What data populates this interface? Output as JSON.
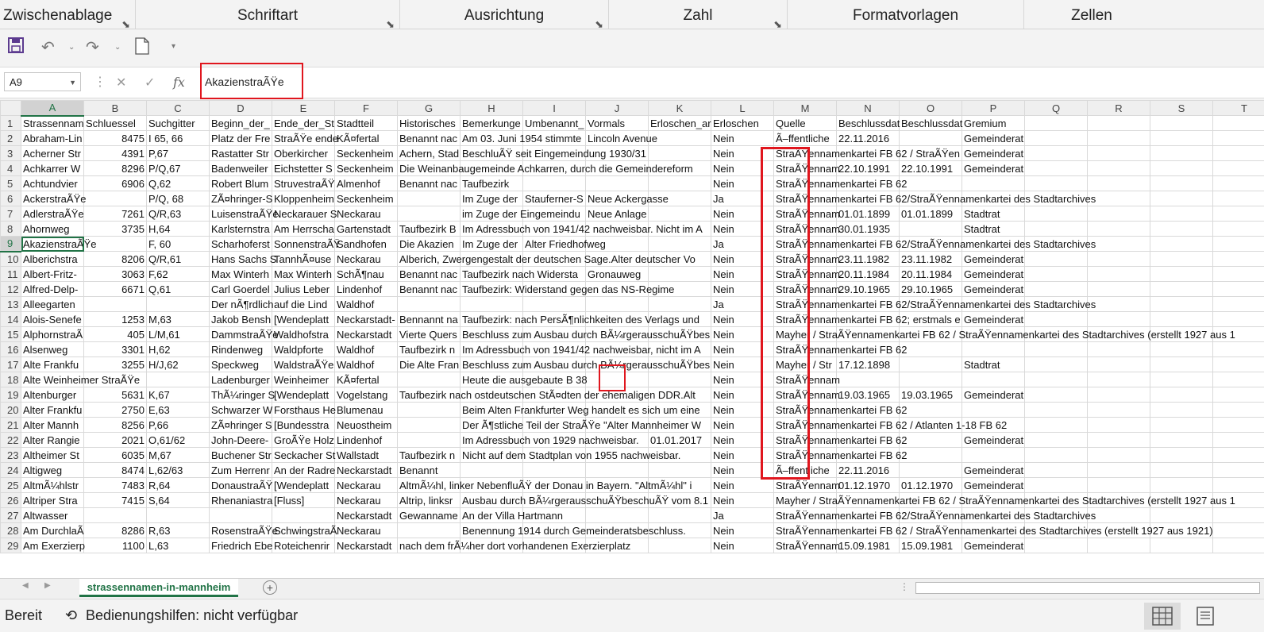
{
  "ribbon": {
    "groups": [
      "Zwischenablage",
      "Schriftart",
      "Ausrichtung",
      "Zahl",
      "Formatvorlagen",
      "Zellen"
    ]
  },
  "name_box": "A9",
  "formula": "AkazienstraÃŸe",
  "fx_label": "fx",
  "columns": [
    "A",
    "B",
    "C",
    "D",
    "E",
    "F",
    "G",
    "H",
    "I",
    "J",
    "K",
    "L",
    "M",
    "N",
    "O",
    "P",
    "Q",
    "R",
    "S",
    "T"
  ],
  "rows": [
    [
      "Strassennam",
      "Schluessel",
      "Suchgitter",
      "Beginn_der_",
      "Ende_der_St",
      "Stadtteil",
      "Historisches",
      "Bemerkunge",
      "Umbenannt_",
      "Vormals",
      "Erloschen_ar",
      "Erloschen",
      "Quelle",
      "Beschlussdat",
      "Beschlussdat",
      "Gremium"
    ],
    [
      "Abraham-Lin",
      "8475",
      "I 65, 66",
      "Platz der Fre",
      "StraÃŸe ende",
      "KÃ¤fertal",
      "Benannt nac",
      "Am 03. Juni 1954 stimmte",
      "",
      "Lincoln Avenue",
      "",
      "Nein",
      "Ã–ffentliche",
      "22.11.2016",
      "",
      "Gemeinderat"
    ],
    [
      "Acherner Str",
      "4391",
      "P,67",
      "Rastatter Str",
      "Oberkircher",
      "Seckenheim",
      "Achern, Stad",
      "BeschluÃŸ seit Eingemeindung 1930/31",
      "",
      "",
      "",
      "Nein",
      "StraÃŸennamenkartei FB 62 / StraÃŸen",
      "",
      "",
      "Gemeinderat"
    ],
    [
      "Achkarrer W",
      "8296",
      "P/Q,67",
      "Badenweiler",
      "Eichstetter S",
      "Seckenheim",
      "Die Weinanbaugemeinde Achkarren, durch die Gemeindereform",
      "",
      "",
      "",
      "",
      "Nein",
      "StraÃŸennam",
      "22.10.1991",
      "22.10.1991",
      "Gemeinderat"
    ],
    [
      "Achtundvier",
      "6906",
      "Q,62",
      "Robert Blum",
      "StruvestraÃŸ",
      "Almenhof",
      "Benannt nac",
      "Taufbezirk",
      "",
      "",
      "",
      "Nein",
      "StraÃŸennamenkartei FB 62",
      "",
      "",
      ""
    ],
    [
      "AckerstraÃŸe",
      "",
      "P/Q, 68",
      "ZÃ¤hringer-S",
      "Kloppenheim",
      "Seckenheim",
      "",
      "Im Zuge der",
      "Stauferner-S",
      "Neue Ackergasse",
      "",
      "Ja",
      "StraÃŸennamenkartei FB 62/StraÃŸennamenkartei des Stadtarchives",
      "",
      "",
      ""
    ],
    [
      "AdlerstraÃŸe",
      "7261",
      "Q/R,63",
      "LuisenstraÃŸe",
      "Neckarauer S",
      "Neckarau",
      "",
      "im Zuge der Eingemeindu",
      "",
      "Neue Anlage",
      "",
      "Nein",
      "StraÃŸennam",
      "01.01.1899",
      "01.01.1899",
      "Stadtrat"
    ],
    [
      "Ahornweg",
      "3735",
      "H,64",
      "Karlsternstra",
      "Am Herrscha",
      "Gartenstadt",
      "Taufbezirk B",
      "Im Adressbuch von 1941/42 nachweisbar. Nicht im A",
      "",
      "",
      "",
      "Nein",
      "StraÃŸennam",
      "30.01.1935",
      "",
      "Stadtrat"
    ],
    [
      "AkazienstraÃŸe",
      "",
      "F, 60",
      "Scharhoferst",
      "SonnenstraÃŸ",
      "Sandhofen",
      "Die Akazien",
      "Im Zuge der",
      "Alter Friedhofweg",
      "",
      "",
      "Ja",
      "StraÃŸennamenkartei FB 62/StraÃŸennamenkartei des Stadtarchives",
      "",
      "",
      ""
    ],
    [
      "Alberichstra",
      "8206",
      "Q/R,61",
      "Hans Sachs S",
      "TannhÃ¤use",
      "Neckarau",
      "Alberich, Zwergengestalt der deutschen Sage.Alter deutscher Vo",
      "",
      "",
      "",
      "",
      "Nein",
      "StraÃŸennam",
      "23.11.1982",
      "23.11.1982",
      "Gemeinderat"
    ],
    [
      "Albert-Fritz-",
      "3063",
      "F,62",
      "Max Winterh",
      "Max Winterh",
      "SchÃ¶nau",
      "Benannt nac",
      "Taufbezirk nach Widersta",
      "",
      "Gronauweg",
      "",
      "Nein",
      "StraÃŸennam",
      "20.11.1984",
      "20.11.1984",
      "Gemeinderat"
    ],
    [
      "Alfred-Delp-",
      "6671",
      "Q,61",
      "Carl Goerdel",
      "Julius Leber",
      "Lindenhof",
      "Benannt nac",
      "Taufbezirk: Widerstand gegen das NS-Regime",
      "",
      "",
      "",
      "Nein",
      "StraÃŸennam",
      "29.10.1965",
      "29.10.1965",
      "Gemeinderat"
    ],
    [
      "Alleegarten",
      "",
      "",
      "Der nÃ¶rdlich",
      "auf die Lind",
      "Waldhof",
      "",
      "",
      "",
      "",
      "",
      "Ja",
      "StraÃŸennamenkartei FB 62/StraÃŸennamenkartei des Stadtarchives",
      "",
      "",
      ""
    ],
    [
      "Alois-Senefe",
      "1253",
      "M,63",
      "Jakob Bensh",
      "[Wendeplatt",
      "Neckarstadt-",
      "Bennannt na",
      "Taufbezirk: nach PersÃ¶nlichkeiten des Verlags und",
      "",
      "",
      "",
      "Nein",
      "StraÃŸennamenkartei FB 62; erstmals e",
      "",
      "",
      "Gemeinderat"
    ],
    [
      "AlphornstraÃ",
      "405",
      "L/M,61",
      "DammstraÃŸe",
      "Waldhofstra",
      "Neckarstadt",
      "Vierte Quers",
      "Beschluss zum Ausbau durch BÃ¼rgerausschuÃŸbes",
      "",
      "",
      "",
      "Nein",
      "Mayher /  StraÃŸennamenkartei FB 62 / StraÃŸennamenkartei des Stadtarchives (erstellt 1927 aus 1",
      "",
      "",
      ""
    ],
    [
      "Alsenweg",
      "3301",
      "H,62",
      "Rindenweg",
      "Waldpforte",
      "Waldhof",
      "Taufbezirk n",
      "Im Adressbuch von 1941/42 nachweisbar, nicht im A",
      "",
      "",
      "",
      "Nein",
      "StraÃŸennamenkartei FB 62",
      "",
      "",
      ""
    ],
    [
      "Alte Frankfu",
      "3255",
      "H/J,62",
      "Speckweg",
      "WaldstraÃŸe",
      "Waldhof",
      "Die Alte Fran",
      "Beschluss zum Ausbau durch BÃ¼rgerausschuÃŸbes",
      "",
      "",
      "",
      "Nein",
      "Mayher / Str",
      "17.12.1898",
      "",
      "Stadtrat"
    ],
    [
      "Alte Weinheimer StraÃŸe",
      "",
      "",
      "Ladenburger",
      "Weinheimer",
      "KÃ¤fertal",
      "",
      "Heute die ausgebaute B 38",
      "",
      "",
      "",
      "Nein",
      "StraÃŸennam",
      "",
      "",
      ""
    ],
    [
      "Altenburger",
      "5631",
      "K,67",
      "ThÃ¼ringer S",
      "[Wendeplatt",
      "Vogelstang",
      "Taufbezirk nach ostdeutschen StÃ¤dten der ehemaligen DDR.Alt",
      "",
      "",
      "",
      "",
      "Nein",
      "StraÃŸennam",
      "19.03.1965",
      "19.03.1965",
      "Gemeinderat"
    ],
    [
      "Alter Frankfu",
      "2750",
      "E,63",
      "Schwarzer W",
      "Forsthaus He",
      "Blumenau",
      "",
      "Beim Alten Frankfurter Weg handelt es sich um eine",
      "",
      "",
      "",
      "Nein",
      "StraÃŸennamenkartei FB 62",
      "",
      "",
      ""
    ],
    [
      "Alter Mannh",
      "8256",
      "P,66",
      "ZÃ¤hringer S",
      "[Bundesstra",
      "Neuostheim",
      "",
      "Der Ã¶stliche Teil der StraÃŸe  \"Alter Mannheimer W",
      "",
      "",
      "",
      "Nein",
      "StraÃŸennamenkartei FB 62 / Atlanten 1-18 FB 62",
      "",
      "",
      ""
    ],
    [
      "Alter Rangie",
      "2021",
      "O,61/62",
      "John-Deere-",
      "GroÃŸe Holz",
      "Lindenhof",
      "",
      "Im Adressbuch von 1929 nachweisbar.",
      "",
      "",
      "01.01.2017",
      "Nein",
      "StraÃŸennamenkartei FB 62",
      "",
      "",
      "Gemeinderat"
    ],
    [
      "Altheimer St",
      "6035",
      "M,67",
      "Buchener Str",
      "Seckacher St",
      "Wallstadt",
      "Taufbezirk n",
      "Nicht auf dem Stadtplan von 1955 nachweisbar.",
      "",
      "",
      "",
      "Nein",
      "StraÃŸennamenkartei FB 62",
      "",
      "",
      ""
    ],
    [
      "Altigweg",
      "8474",
      "L,62/63",
      "Zum Herrenr",
      "An der Radre",
      "Neckarstadt",
      "Benannt",
      "",
      "",
      "",
      "",
      "Nein",
      "Ã–ffentliche",
      "22.11.2016",
      "",
      "Gemeinderat"
    ],
    [
      "AltmÃ¼hlstr",
      "7483",
      "R,64",
      "DonaustraÃŸ",
      "[Wendeplatt",
      "Neckarau",
      "AltmÃ¼hl, linker NebenfluÃŸ der Donau in Bayern. \"AltmÃ¼hl\" i",
      "",
      "",
      "",
      "",
      "Nein",
      "StraÃŸennam",
      "01.12.1970",
      "01.12.1970",
      "Gemeinderat"
    ],
    [
      "Altriper Stra",
      "7415",
      "S,64",
      "Rhenaniastra",
      "[Fluss]",
      "Neckarau",
      "Altrip, linksr",
      "Ausbau durch BÃ¼rgerausschuÃŸbeschuÃŸ vom 8.1",
      "",
      "",
      "",
      "Nein",
      "Mayher / StraÃŸennamenkartei FB 62 / StraÃŸennamenkartei des Stadtarchives (erstellt 1927 aus 1",
      "",
      "",
      ""
    ],
    [
      "Altwasser",
      "",
      "",
      "",
      "",
      "Neckarstadt",
      "Gewanname",
      "An der Villa Hartmann",
      "",
      "",
      "",
      "Ja",
      "StraÃŸennamenkartei FB 62/StraÃŸennamenkartei des Stadtarchives",
      "",
      "",
      ""
    ],
    [
      "Am DurchlaÃ",
      "8286",
      "R,63",
      "RosenstraÃŸe",
      "SchwingstraÃ",
      "Neckarau",
      "",
      "Benennung 1914 durch Gemeinderatsbeschluss.",
      "",
      "",
      "",
      "Nein",
      "StraÃŸennamenkartei FB 62 / StraÃŸennamenkartei des Stadtarchives (erstellt 1927 aus 1921)",
      "",
      "",
      ""
    ],
    [
      "Am Exerzierp",
      "1100",
      "L,63",
      "Friedrich Ebe",
      "Roteichenrir",
      "Neckarstadt",
      "nach dem frÃ¼her dort vorhandenen Exerzierplatz",
      "",
      "",
      "",
      "",
      "Nein",
      "StraÃŸennam",
      "15.09.1981",
      "15.09.1981",
      "Gemeinderat"
    ]
  ],
  "active_row": 9,
  "sheet_tab": "strassennamen-in-mannheim",
  "status": {
    "ready": "Bereit",
    "accessibility": "Bedienungshilfen: nicht verfügbar"
  },
  "colors": {
    "accent": "#217346",
    "highlight": "#e0161e"
  }
}
